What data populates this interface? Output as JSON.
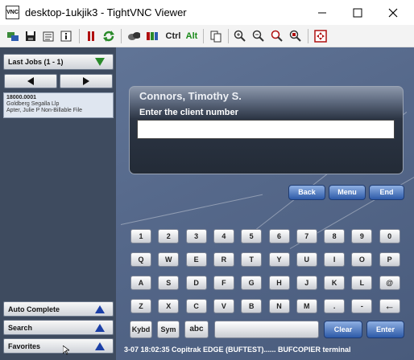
{
  "window": {
    "title": "desktop-1ukjik3 - TightVNC Viewer",
    "app_icon_text": "VNC",
    "controls": {
      "minimize": "—",
      "maximize": "☐",
      "close": "✕"
    }
  },
  "toolbar": {
    "ctrl_label": "Ctrl",
    "alt_label": "Alt",
    "icons": [
      "new-connection-icon",
      "save-icon",
      "options-icon",
      "info-icon",
      "pause-icon",
      "refresh-icon",
      "ctrl-alt-del-icon",
      "ctrl-esc-icon",
      "send-ctrl-icon",
      "send-alt-icon",
      "clipboard-icon",
      "zoom-in-icon",
      "zoom-out-icon",
      "zoom-100-icon",
      "zoom-fit-icon",
      "fullscreen-icon"
    ]
  },
  "left_panel": {
    "last_jobs_label": "Last Jobs (1 - 1)",
    "prev_arrow": "◄",
    "next_arrow": "►",
    "job": {
      "number": "18000.0001",
      "client": "Goldberg Segalla Llp",
      "matter": "Apter, Julie P Non-Billable File"
    },
    "auto_complete_label": "Auto Complete",
    "search_label": "Search",
    "favorites_label": "Favorites"
  },
  "dialog": {
    "name": "Connors, Timothy S.",
    "prompt": "Enter the client number",
    "input_value": ""
  },
  "nav_buttons": {
    "back": "Back",
    "menu": "Menu",
    "end": "End"
  },
  "keyboard": {
    "row1": [
      "1",
      "2",
      "3",
      "4",
      "5",
      "6",
      "7",
      "8",
      "9",
      "0"
    ],
    "row2": [
      "Q",
      "W",
      "E",
      "R",
      "T",
      "Y",
      "U",
      "I",
      "O",
      "P"
    ],
    "row3": [
      "A",
      "S",
      "D",
      "F",
      "G",
      "H",
      "J",
      "K",
      "L",
      "@"
    ],
    "row4": [
      "Z",
      "X",
      "C",
      "V",
      "B",
      "N",
      "M",
      ".",
      "-",
      "←"
    ],
    "kybd": "Kybd",
    "sym": "Sym",
    "abc": "abc",
    "clear": "Clear",
    "enter": "Enter"
  },
  "status_bar": "3-07 18:02:35 Copitrak EDGE (BUFTEST)...... BUFCOPIER terminal",
  "colors": {
    "screen_bg": "#56698b",
    "left_panel_bg": "#3e4b5f",
    "blue_button": "#2d5aa8",
    "triangle_blue": "#1b3fa6",
    "triangle_green": "#2a8a2a"
  }
}
